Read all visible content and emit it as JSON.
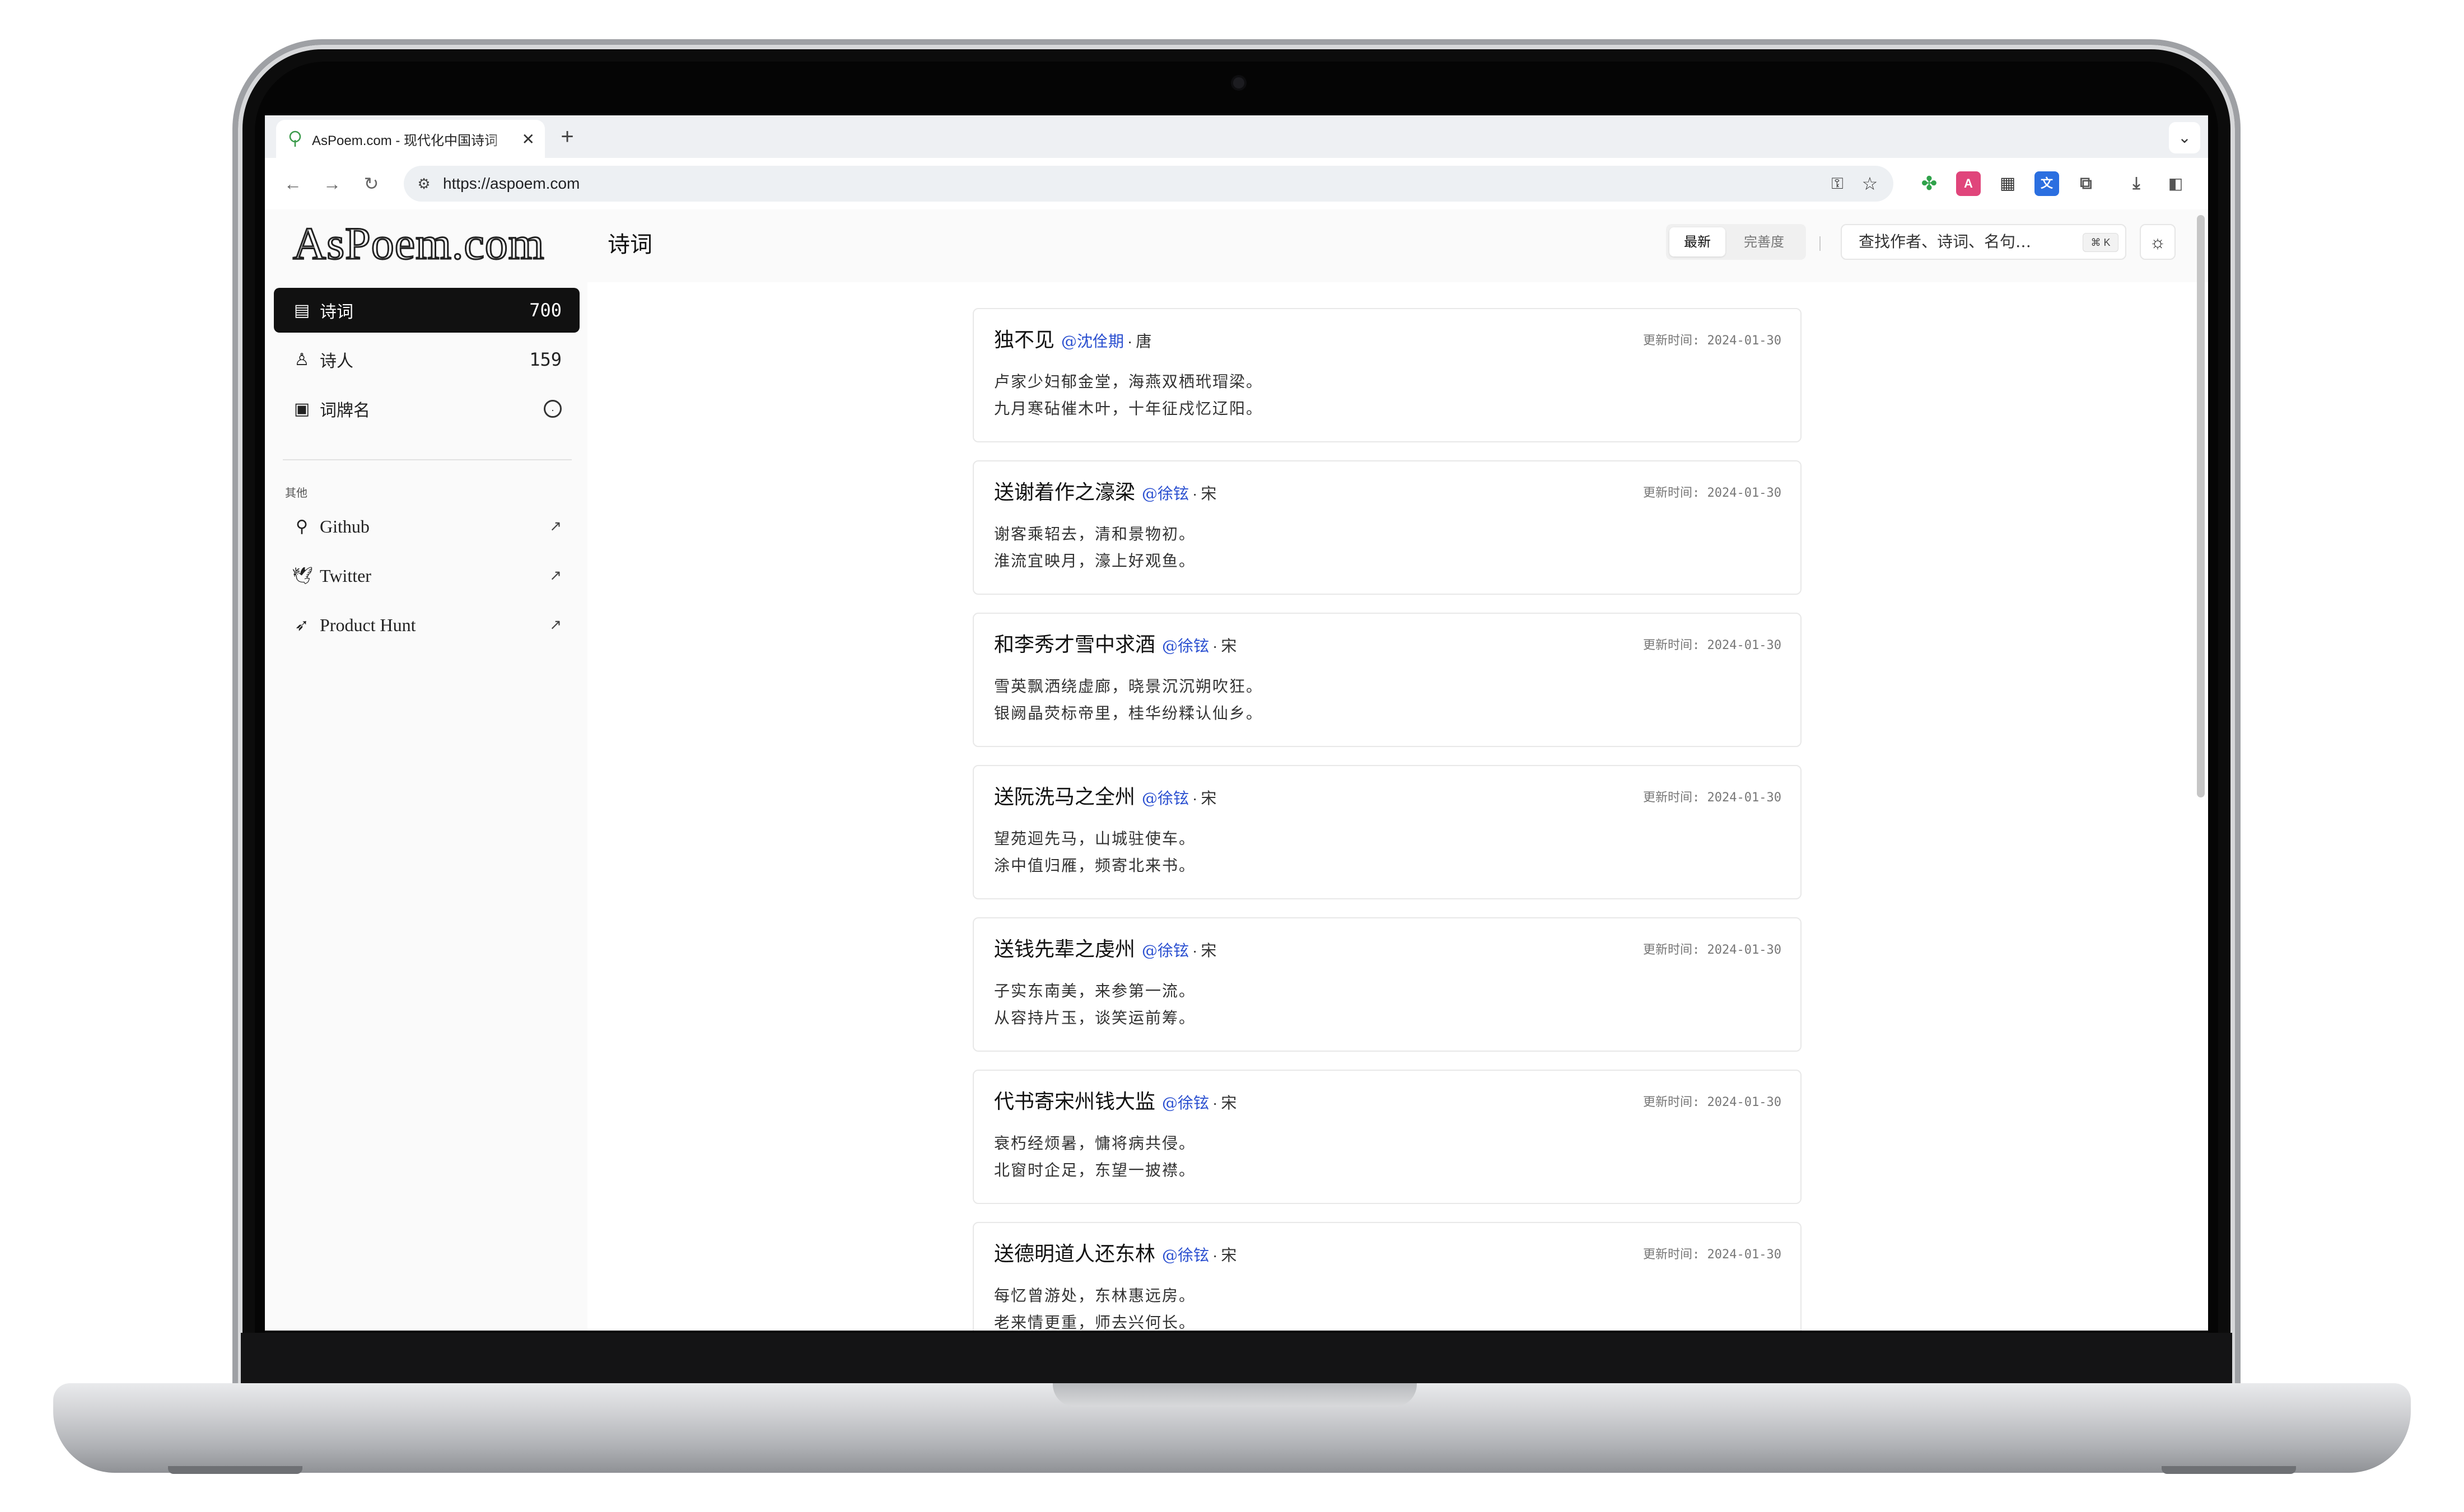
{
  "browser": {
    "tab_title": "AsPoem.com - 现代化中国诗词",
    "tab_close": "✕",
    "new_tab": "+",
    "tab_menu": "⌄",
    "url": "https://aspoem.com",
    "nav_back": "←",
    "nav_forward": "→",
    "nav_reload": "↻",
    "icons": [
      "password-key-icon",
      "bookmark-star-icon",
      "extension-green-icon",
      "extension-pink-icon",
      "qr-code-icon",
      "translate-icon",
      "puzzle-extensions-icon",
      "download-icon",
      "side-panel-icon",
      "profile-avatar-icon",
      "more-menu-icon"
    ]
  },
  "site": {
    "logo": "AsPoem.com"
  },
  "sidebar": {
    "items": [
      {
        "label": "诗词",
        "count": "700",
        "icon": "layout-icon"
      },
      {
        "label": "诗人",
        "count": "159",
        "icon": "user-icon"
      },
      {
        "label": "词牌名",
        "count": "",
        "icon": "book-icon"
      }
    ],
    "section_label": "其他",
    "links": [
      {
        "label": "Github",
        "icon": "github-icon",
        "arrow": "↗"
      },
      {
        "label": "Twitter",
        "icon": "twitter-icon",
        "arrow": "↗"
      },
      {
        "label": "Product Hunt",
        "icon": "rocket-icon",
        "arrow": "↗"
      }
    ]
  },
  "header": {
    "title": "诗词",
    "sort_options": [
      "最新",
      "完善度"
    ],
    "sort_selected": "最新",
    "search_placeholder": "查找作者、诗词、名句…",
    "search_shortcut": "⌘ K"
  },
  "poems": [
    {
      "title": "独不见",
      "author": "@沈佺期",
      "dynasty": "唐",
      "updated": "更新时间: 2024-01-30",
      "lines": [
        "卢家少妇郁金堂，海燕双栖玳瑁梁。",
        "九月寒砧催木叶，十年征戍忆辽阳。"
      ]
    },
    {
      "title": "送谢着作之濠梁",
      "author": "@徐铉",
      "dynasty": "宋",
      "updated": "更新时间: 2024-01-30",
      "lines": [
        "谢客乘轺去，清和景物初。",
        "淮流宜映月，濠上好观鱼。"
      ]
    },
    {
      "title": "和李秀才雪中求酒",
      "author": "@徐铉",
      "dynasty": "宋",
      "updated": "更新时间: 2024-01-30",
      "lines": [
        "雪英飘洒绕虚廊，晓景沉沉朔吹狂。",
        "银阙晶荧标帝里，桂华纷糅认仙乡。"
      ]
    },
    {
      "title": "送阮洗马之全州",
      "author": "@徐铉",
      "dynasty": "宋",
      "updated": "更新时间: 2024-01-30",
      "lines": [
        "望苑迴先马，山城驻使车。",
        "涂中值归雁，频寄北来书。"
      ]
    },
    {
      "title": "送钱先辈之虔州",
      "author": "@徐铉",
      "dynasty": "宋",
      "updated": "更新时间: 2024-01-30",
      "lines": [
        "子实东南美，来参第一流。",
        "从容持片玉，谈笑运前筹。"
      ]
    },
    {
      "title": "代书寄宋州钱大监",
      "author": "@徐铉",
      "dynasty": "宋",
      "updated": "更新时间: 2024-01-30",
      "lines": [
        "衰朽经烦暑，慵将病共侵。",
        "北窗时企足，东望一披襟。"
      ]
    },
    {
      "title": "送德明道人还东林",
      "author": "@徐铉",
      "dynasty": "宋",
      "updated": "更新时间: 2024-01-30",
      "lines": [
        "每忆曾游处，东林惠远房。",
        "老来情更重，师去兴何长。"
      ]
    }
  ]
}
